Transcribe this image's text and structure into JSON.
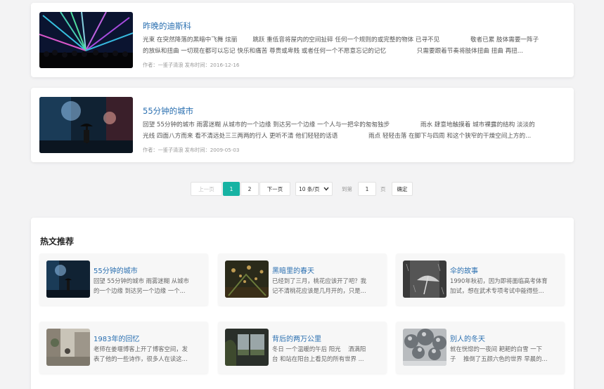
{
  "articles": [
    {
      "title": "昨晚的迪斯科",
      "desc_line1": "光束 在突然降落的黑暗中飞舞 炫丽        跳跃 重低音将屋内的空间扯碎 任何一个规则的或完整的物体 已寻不见                敬者已累 肢体需要一阵子",
      "desc_line2": "的放纵和扭曲 一切现在都可以忘记 快乐和痛苦 尊贵或卑贱 或者任何一个不愿意忘记的记忆                只需要跟着节奏将肢体扭曲 扭曲 再扭...",
      "meta": "作者：一鉴子清浪 发布时间：2016-12-16",
      "thumb_icon": "disco-laser-photo-icon"
    },
    {
      "title": "55分钟的城市",
      "desc_line1": "回望 55分钟的城市 雨雾迷糊 从城市的一个边缘 到达另一个边缘 一个人与一把伞的匆匆独步                雨水 肆意地触摸着 城市裸露的结构 淡淡的",
      "desc_line2": "光线 四面八方而来 看不清远处三三两两的行人 更听不清 他们轻轻的话语                雨点 轻轻击落 在脚下与四周 和这个狭窄的干燥空间上方的...",
      "meta": "作者：一鉴子清浪 发布时间：2009-05-03",
      "thumb_icon": "rainy-city-umbrella-photo-icon"
    }
  ],
  "pagination": {
    "prev": "上一页",
    "pages": [
      "1",
      "2"
    ],
    "current": "1",
    "next": "下一页",
    "per_page": "10 条/页",
    "goto_prefix": "到第",
    "goto_value": "1",
    "goto_suffix": "页",
    "confirm": "确定"
  },
  "hot": {
    "heading": "热文推荐",
    "items": [
      {
        "title": "55分钟的城市",
        "desc": "回望 55分钟的城市 雨雾迷糊 从城市\n的一个边缘 到达另一个边缘 一个...",
        "thumb_icon": "rainy-city-umbrella-photo-icon"
      },
      {
        "title": "黑暗里的春天",
        "desc": "已经到了三月，桃花应该开了吧？我\n记不清桃花应该是几月开的，只是...",
        "thumb_icon": "night-tree-lights-photo-icon"
      },
      {
        "title": "伞的故事",
        "desc": "1990年秋初，因为即将面临高考体育\n加试，想在武术专项考试中能得些...",
        "thumb_icon": "umbrella-rain-bw-photo-icon"
      },
      {
        "title": "1983年的回忆",
        "desc": "老师在姜堰博客上开了博客空间，发\n表了他的一些诗作，很多人在读这...",
        "thumb_icon": "old-street-photo-icon"
      },
      {
        "title": "背后的两万公里",
        "desc": "冬日 一个温暖的午后 阳光    洒满阳\n台 和站在阳台上看见的所有世界 ...",
        "thumb_icon": "window-view-photo-icon"
      },
      {
        "title": "别人的冬天",
        "desc": "就在恍惚的一夜间 耙耙的白雪 一下\n子    推倒了五颜六色的世界 早晨的...",
        "thumb_icon": "snowy-trees-photo-icon"
      }
    ]
  }
}
